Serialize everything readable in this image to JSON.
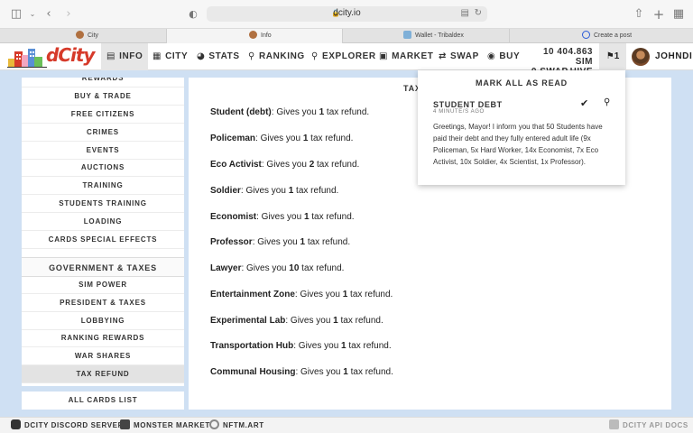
{
  "browser": {
    "url": "dcity.io",
    "tabs": [
      {
        "label": "City"
      },
      {
        "label": "Info"
      },
      {
        "label": "Wallet - Tribaldex"
      },
      {
        "label": "Create a post"
      }
    ]
  },
  "header": {
    "logo_text": "dCity",
    "nav": [
      {
        "label": "INFO",
        "icon": "book-icon"
      },
      {
        "label": "CITY",
        "icon": "city-icon"
      },
      {
        "label": "STATS",
        "icon": "pie-chart-icon"
      },
      {
        "label": "RANKING",
        "icon": "trophy-icon"
      },
      {
        "label": "EXPLORER",
        "icon": "search-icon"
      },
      {
        "label": "MARKET",
        "icon": "cart-icon"
      },
      {
        "label": "SWAP",
        "icon": "swap-icon"
      },
      {
        "label": "BUY",
        "icon": "coins-icon"
      }
    ],
    "balance_sim": "10 404.863 SIM",
    "balance_swap": "0 SWAP.HIVE",
    "notification_count": "1",
    "username": "JOHNDIE"
  },
  "sidebar": {
    "items_top": [
      {
        "label": "REWARDS"
      },
      {
        "label": "BUY & TRADE"
      },
      {
        "label": "FREE CITIZENS"
      },
      {
        "label": "CRIMES"
      },
      {
        "label": "EVENTS"
      },
      {
        "label": "AUCTIONS"
      },
      {
        "label": "TRAINING"
      },
      {
        "label": "STUDENTS TRAINING"
      },
      {
        "label": "LOADING"
      },
      {
        "label": "CARDS SPECIAL EFFECTS"
      }
    ],
    "section_title": "GOVERNMENT & TAXES",
    "items_section": [
      {
        "label": "SIM POWER"
      },
      {
        "label": "PRESIDENT & TAXES"
      },
      {
        "label": "LOBBYING"
      },
      {
        "label": "RANKING REWARDS"
      },
      {
        "label": "WAR SHARES"
      },
      {
        "label": "TAX REFUND"
      }
    ],
    "selected": "TAX REFUND",
    "bottom": "ALL CARDS LIST"
  },
  "main": {
    "title": "TAX",
    "refunds": [
      {
        "name": "Student (debt)",
        "pre": ": Gives you ",
        "amount": "1",
        "post": " tax refund."
      },
      {
        "name": "Policeman",
        "pre": ": Gives you ",
        "amount": "1",
        "post": " tax refund."
      },
      {
        "name": "Eco Activist",
        "pre": ": Gives you ",
        "amount": "2",
        "post": " tax refund."
      },
      {
        "name": "Soldier",
        "pre": ": Gives you ",
        "amount": "1",
        "post": " tax refund."
      },
      {
        "name": "Economist",
        "pre": ": Gives you ",
        "amount": "1",
        "post": " tax refund."
      },
      {
        "name": "Professor",
        "pre": ": Gives you ",
        "amount": "1",
        "post": " tax refund."
      },
      {
        "name": "Lawyer",
        "pre": ": Gives you ",
        "amount": "10",
        "post": " tax refund."
      },
      {
        "name": "Entertainment Zone",
        "pre": ": Gives you ",
        "amount": "1",
        "post": " tax refund."
      },
      {
        "name": "Experimental Lab",
        "pre": ": Gives you ",
        "amount": "1",
        "post": " tax refund."
      },
      {
        "name": "Transportation Hub",
        "pre": ": Gives you ",
        "amount": "1",
        "post": " tax refund."
      },
      {
        "name": "Communal Housing",
        "pre": ": Gives you ",
        "amount": "1",
        "post": " tax refund."
      }
    ]
  },
  "notifications": {
    "mark_all": "MARK ALL AS READ",
    "items": [
      {
        "title": "STUDENT DEBT",
        "time": "4 MINUTE/S AGO",
        "body": "Greetings, Mayor! I inform you that 50 Students have paid their debt and they fully entered adult life (9x Policeman, 5x Hard Worker, 14x Economist, 7x Eco Activist, 10x Soldier, 4x Scientist, 1x Professor)."
      }
    ]
  },
  "footer": {
    "items": [
      {
        "label": "DCITY DISCORD SERVER",
        "icon": "discord-icon"
      },
      {
        "label": "MONSTER MARKET",
        "icon": "monster-icon"
      },
      {
        "label": "NFTM.ART",
        "icon": "nftm-icon"
      },
      {
        "label": "DCITY API DOCS",
        "icon": "docs-icon"
      }
    ]
  },
  "colors": {
    "page_bg": "#cfe0f3",
    "logo_red": "#d63a2a"
  }
}
